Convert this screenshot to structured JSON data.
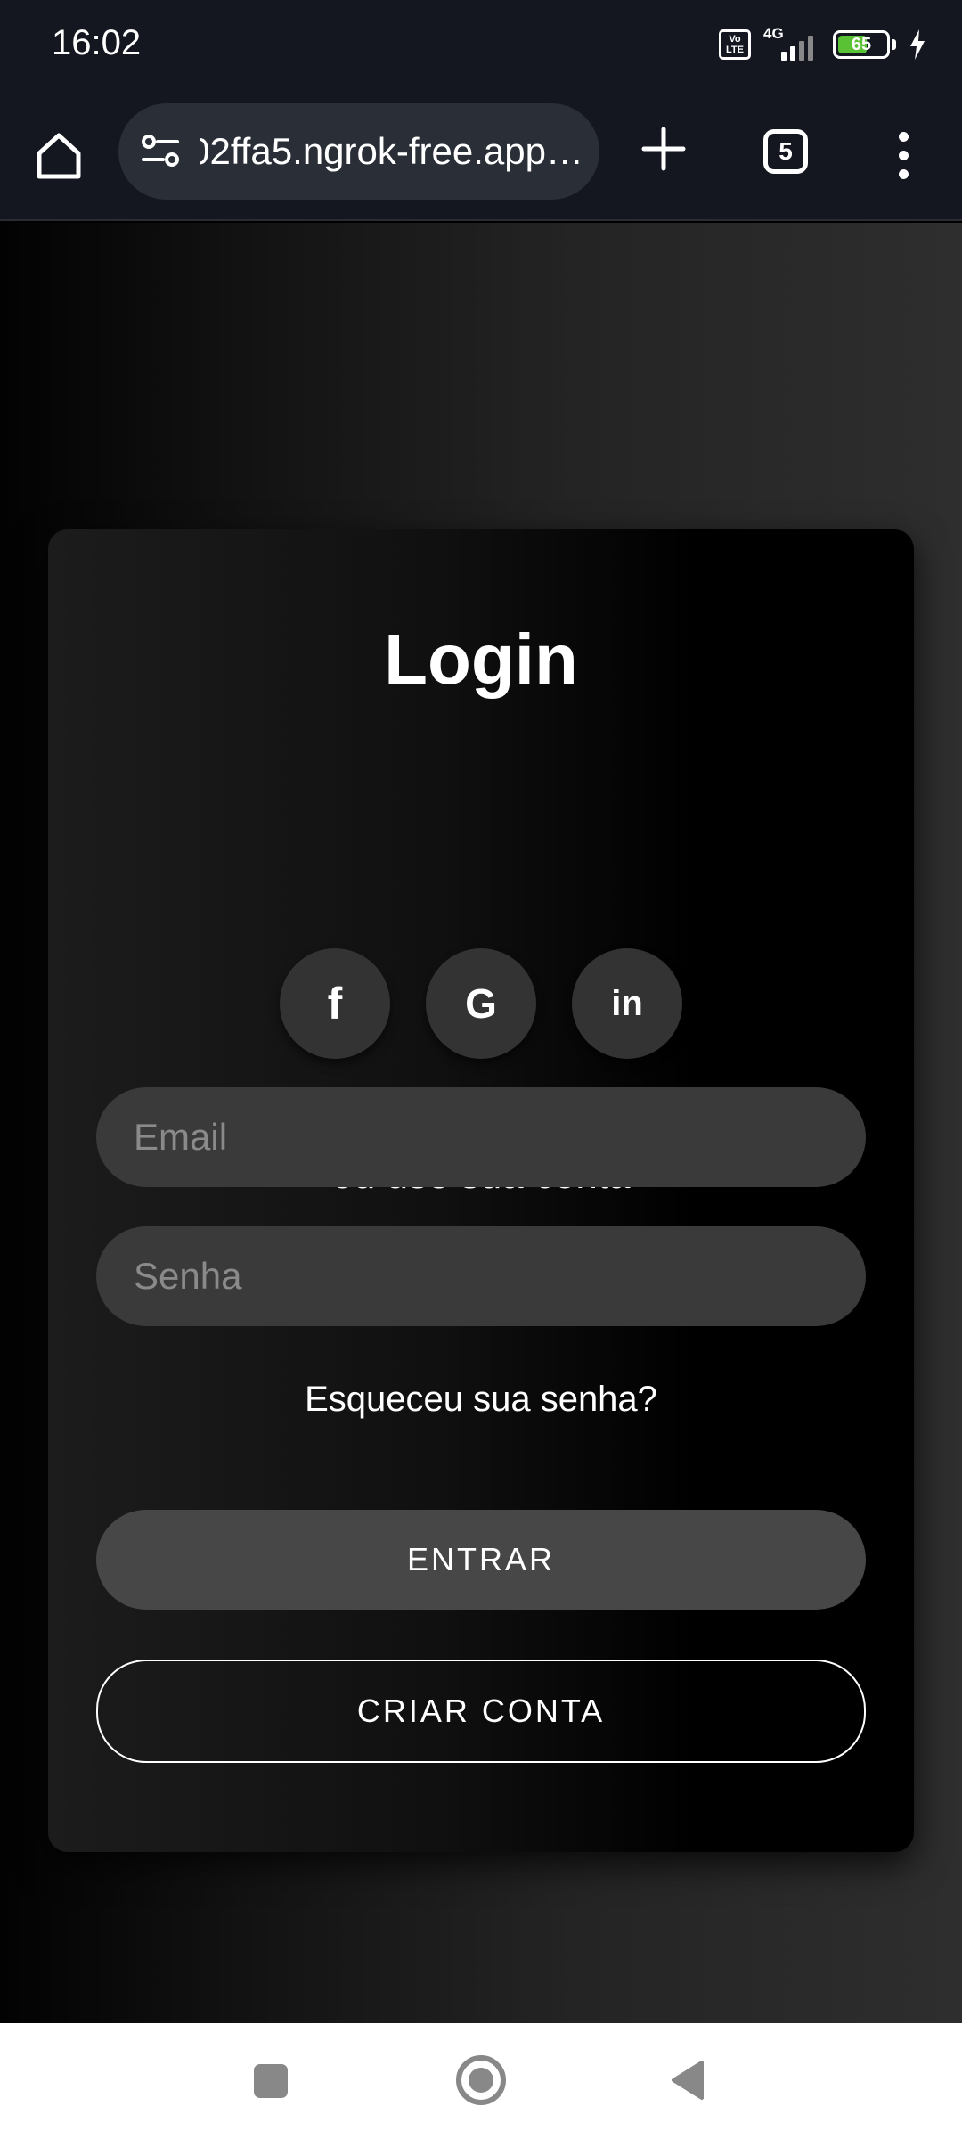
{
  "status_bar": {
    "time": "16:02",
    "volte_label": "Vo LTE",
    "network": "4G",
    "battery_level": "65",
    "battery_percent": 65,
    "charging": true
  },
  "browser": {
    "url": "…02ffa5.ngrok-free.app",
    "tab_count": "5",
    "icons": [
      "home-icon",
      "site-settings-icon",
      "plus-icon",
      "tabs-icon",
      "more-vert-icon"
    ]
  },
  "login": {
    "title": "Login",
    "social": [
      {
        "name": "facebook",
        "glyph": "f"
      },
      {
        "name": "google",
        "glyph": "G"
      },
      {
        "name": "linkedin",
        "glyph": "in"
      }
    ],
    "or_text": "ou use sua conta",
    "email_placeholder": "Email",
    "password_placeholder": "Senha",
    "forgot_text": "Esqueceu sua senha?",
    "enter_label": "ENTRAR",
    "create_label": "CRIAR CONTA"
  },
  "colors": {
    "accent_battery": "#59c134",
    "card_background": "#000000",
    "field_background": "#3a3a3a",
    "button_background": "#474747"
  }
}
